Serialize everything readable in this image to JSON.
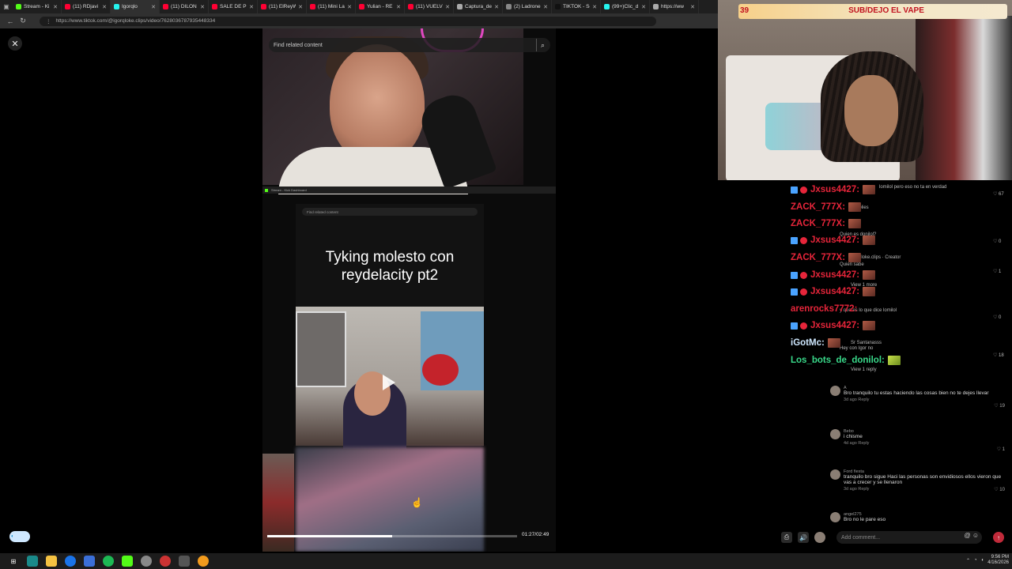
{
  "browser": {
    "tabs": [
      {
        "label": "Stream - Ki",
        "color": "#53fc18"
      },
      {
        "label": "(11) RDjavi I",
        "color": "#ff0033"
      },
      {
        "label": "Igorqlo",
        "color": "#25f4ee",
        "active": true
      },
      {
        "label": "(11) DILON",
        "color": "#ff0033"
      },
      {
        "label": "SALE DE PRI",
        "color": "#ff0033"
      },
      {
        "label": "(11) ElReyW",
        "color": "#ff0033"
      },
      {
        "label": "(11) Mini La",
        "color": "#ff0033"
      },
      {
        "label": "Yulian - RE",
        "color": "#ff0033"
      },
      {
        "label": "(11) VUELV",
        "color": "#ff0033"
      },
      {
        "label": "Captura_de",
        "color": "#aaaaaa"
      },
      {
        "label": "(2) Ladrone",
        "color": "#888888"
      },
      {
        "label": "TIKTOK - Sc",
        "color": "#111111"
      },
      {
        "label": "(99+)Clic_d",
        "color": "#25f4ee"
      },
      {
        "label": "https://ww",
        "color": "#aaaaaa"
      }
    ],
    "url": "https://www.tiktok.com/@igorqloke.clips/video/7628036787935448334"
  },
  "tiktok": {
    "search_placeholder": "Find related content",
    "embed_bar_text": "Stream - Kick Dashboard",
    "inner_search_placeholder": "Find related content",
    "caption": "Tyking molesto con reydelacity pt2",
    "timestamp": "01:27/02:49",
    "progress": 0.5
  },
  "webcam": {
    "count": "39",
    "title": "SUB/DEJO EL VAPE"
  },
  "chat": {
    "messages": [
      {
        "user": "Jxsus4427",
        "color": "#e6253a",
        "badges": true,
        "emotes": 1
      },
      {
        "user": "ZACK_777X",
        "color": "#e6253a",
        "badges": false,
        "emotes": 1
      },
      {
        "user": "ZACK_777X",
        "color": "#e6253a",
        "badges": false,
        "emotes": 1
      },
      {
        "user": "Jxsus4427",
        "color": "#e6253a",
        "badges": true,
        "emotes": 1
      },
      {
        "user": "ZACK_777X",
        "color": "#e6253a",
        "badges": false,
        "emotes": 1
      },
      {
        "user": "Jxsus4427",
        "color": "#e6253a",
        "badges": true,
        "emotes": 1
      },
      {
        "user": "Jxsus4427",
        "color": "#e6253a",
        "badges": true,
        "emotes": 1
      },
      {
        "user": "arenrocks7772",
        "color": "#e6253a",
        "badges": false,
        "emotes": 0
      },
      {
        "user": "Jxsus4427",
        "color": "#e6253a",
        "badges": true,
        "emotes": 1
      },
      {
        "user": "iGotMc",
        "color": "#cfe8ff",
        "badges": false,
        "emotes": 1
      },
      {
        "user": "Los_bots_de_donilol",
        "color": "#39d98a",
        "badges": false,
        "emotes": 1
      }
    ]
  },
  "overlay_comments": [
    {
      "text": "lomilol pero eso no ta en verdad",
      "likes": "67"
    },
    {
      "text": "4 replies",
      "likes": ""
    },
    {
      "text": "Quien es donilol?",
      "likes": "0"
    },
    {
      "text": "igorqloke.clips · Creator",
      "likes": ""
    },
    {
      "text": "Quien sabe",
      "likes": "1"
    },
    {
      "text": "View 1 more",
      "likes": ""
    },
    {
      "text": "y que es lo que dice lomilol",
      "likes": "0"
    },
    {
      "text": "Sr Santanasss",
      "likes": ""
    },
    {
      "text": "Hey con Igor no",
      "likes": "18"
    },
    {
      "text": "View 1 reply",
      "likes": ""
    }
  ],
  "comments": [
    {
      "name": "A",
      "text": "Bro tranquilo tu estas haciendo las cosas bien no te dejes llevar",
      "meta": "3d ago  Reply",
      "likes": "19"
    },
    {
      "name": "Bebo",
      "text": "i chisme",
      "meta": "4d ago  Reply",
      "likes": "1"
    },
    {
      "name": "Ford fiesta",
      "text": "tranquilo bro sigue Haci las personas son envidiosos ellos vieron que vas a crecer y se llenaron",
      "meta": "3d ago  Reply",
      "likes": "10"
    },
    {
      "name": "angel275",
      "text": "Bro no le pare eso",
      "meta": "",
      "likes": ""
    }
  ],
  "comment_input": {
    "placeholder": "Add comment..."
  },
  "taskbar": {
    "time": "9:56 PM",
    "date": "4/16/2026"
  }
}
